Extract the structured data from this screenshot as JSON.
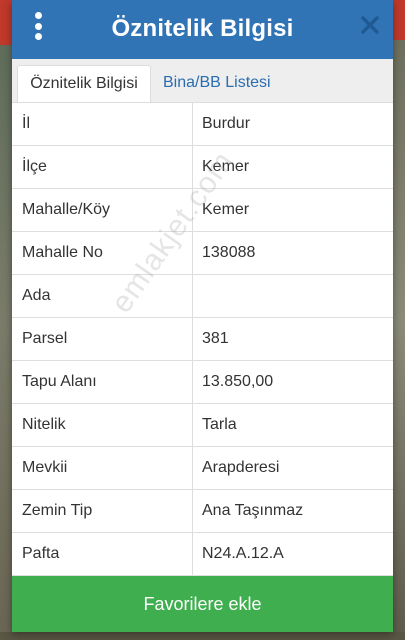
{
  "header": {
    "title": "Öznitelik Bilgisi"
  },
  "tabs": [
    {
      "label": "Öznitelik Bilgisi",
      "active": true
    },
    {
      "label": "Bina/BB Listesi",
      "active": false
    }
  ],
  "attributes": [
    {
      "key": "İl",
      "value": "Burdur"
    },
    {
      "key": "İlçe",
      "value": "Kemer"
    },
    {
      "key": "Mahalle/Köy",
      "value": "Kemer"
    },
    {
      "key": "Mahalle No",
      "value": "138088"
    },
    {
      "key": "Ada",
      "value": ""
    },
    {
      "key": "Parsel",
      "value": "381"
    },
    {
      "key": "Tapu Alanı",
      "value": "13.850,00"
    },
    {
      "key": "Nitelik",
      "value": "Tarla"
    },
    {
      "key": "Mevkii",
      "value": "Arapderesi"
    },
    {
      "key": "Zemin Tip",
      "value": "Ana Taşınmaz"
    },
    {
      "key": "Pafta",
      "value": "N24.A.12.A"
    }
  ],
  "footer": {
    "favorite_label": "Favorilere ekle"
  },
  "watermark": "emlakjet.com",
  "colors": {
    "header": "#3174b5",
    "button": "#3fae4f",
    "tab_link": "#2a6db0"
  }
}
